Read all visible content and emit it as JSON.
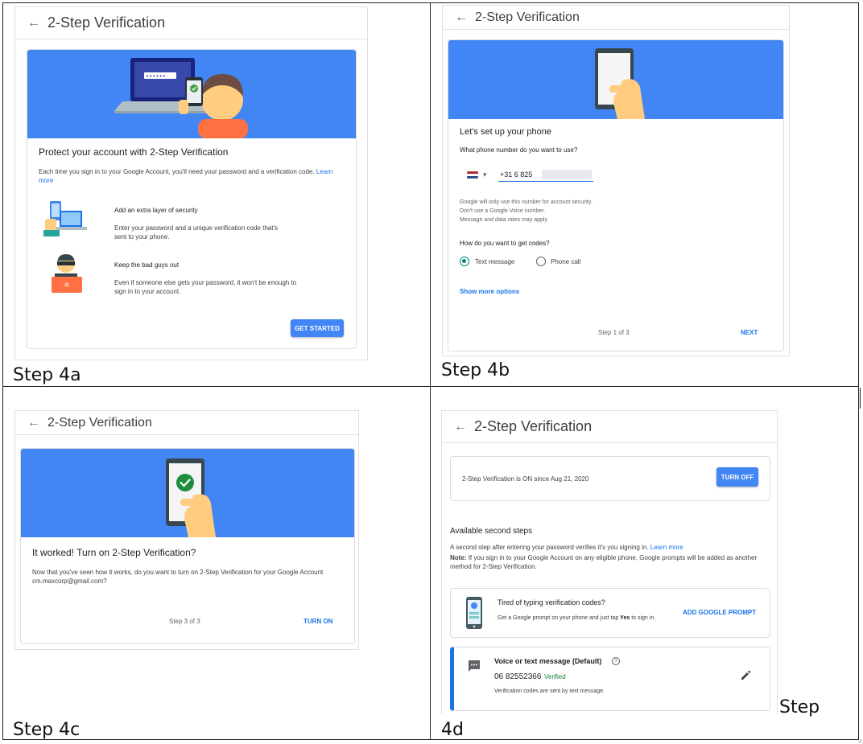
{
  "common": {
    "panel_title": "2-Step Verification",
    "back_glyph": "←"
  },
  "captions": {
    "a": "Step 4a",
    "b": "Step 4b",
    "c": "Step 4c",
    "d_line1": "Step",
    "d_line2": "4d"
  },
  "step4a": {
    "heading": "Protect your account with 2-Step Verification",
    "intro": "Each time you sign in to your Google Account, you'll need your password and a verification code.",
    "learn_more": "Learn more",
    "feature1_title": "Add an extra layer of security",
    "feature1_desc": "Enter your password and a unique verification code that's sent to your phone.",
    "feature2_title": "Keep the bad guys out",
    "feature2_desc": "Even if someone else gets your password, it won't be enough to sign in to your account.",
    "button": "GET STARTED",
    "login_dots": "••••••"
  },
  "step4b": {
    "heading": "Let's set up your phone",
    "question": "What phone number do you want to use?",
    "phone_value": "+31 6 825",
    "note1": "Google will only use this number for account security.",
    "note2": "Don't use a Google Voice number.",
    "note3": "Message and data rates may apply.",
    "codes_question": "How do you want to get codes?",
    "option_text": "Text message",
    "option_call": "Phone call",
    "show_more": "Show more options",
    "step_label": "Step 1 of 3",
    "next": "NEXT",
    "dropdown_glyph": "▾"
  },
  "step4c": {
    "heading": "It worked! Turn on 2-Step Verification?",
    "body": "Now that you've seen how it works, do you want to turn on 2-Step Verification for your Google Account cm.maxcorp@gmail.com?",
    "step_label": "Step 3 of 3",
    "turn_on": "TURN ON"
  },
  "step4d": {
    "status": "2-Step Verification is ON since Aug 21, 2020",
    "turn_off": "TURN OFF",
    "available_heading": "Available second steps",
    "available_desc": "A second step after entering your password verifies it's you signing in.",
    "learn_more": "Learn more",
    "note_label": "Note:",
    "note_text": "If you sign in to your Google Account on any eligible phone, Google prompts will be added as another method for 2-Step Verification.",
    "prompt_title": "Tired of typing verification codes?",
    "prompt_desc_pre": "Get a Google prompt on your phone and just tap",
    "prompt_desc_yes": "Yes",
    "prompt_desc_post": "to sign in.",
    "add_prompt": "ADD GOOGLE PROMPT",
    "voice_title": "Voice or text message (Default)",
    "voice_number": "06 82552366",
    "verified": "Verified",
    "voice_desc": "Verification codes are sent by text message.",
    "help_glyph": "?"
  },
  "colors": {
    "google_blue": "#4285f4",
    "link_blue": "#1a73e8",
    "verified_green": "#188038",
    "check_green": "#1e8e3e",
    "default_bar": "#1a73e8"
  },
  "icons": [
    "back-arrow-icon",
    "checkmark-icon",
    "edit-pencil-icon",
    "message-icon",
    "help-icon",
    "dropdown-icon",
    "netherlands-flag-icon"
  ]
}
